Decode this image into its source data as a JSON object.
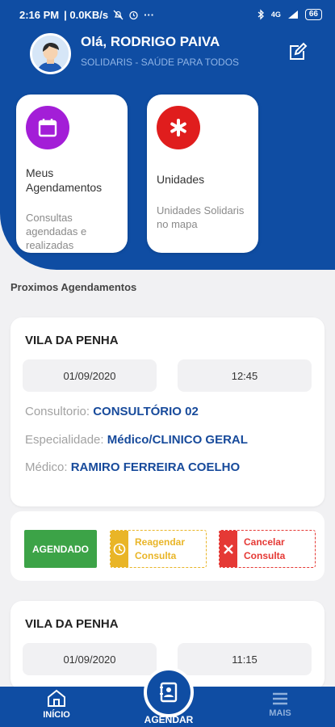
{
  "status_bar": {
    "time": "2:16 PM",
    "speed": "| 0.0KB/s",
    "more": "···",
    "network": "4G",
    "battery": "66"
  },
  "header": {
    "greeting": "Olá, RODRIGO PAIVA",
    "subtitle": "SOLIDARIS - SAÚDE PARA TODOS"
  },
  "cards": [
    {
      "title": "Meus Agendamentos",
      "desc": "Consultas agendadas e realizadas",
      "icon": "calendar-icon",
      "color": "#a31ed7"
    },
    {
      "title": "Unidades",
      "desc": "Unidades Solidaris no mapa",
      "icon": "asterisk-icon",
      "color": "#e01d1d"
    }
  ],
  "section_title": "Proximos Agendamentos",
  "appointments": [
    {
      "unit": "VILA DA PENHA",
      "date": "01/09/2020",
      "time": "12:45",
      "office_label": "Consultorio:",
      "office": "CONSULTÓRIO 02",
      "specialty_label": "Especialidade:",
      "specialty": "Médico/CLINICO GERAL",
      "doctor_label": "Médico:",
      "doctor": "RAMIRO FERREIRA COELHO"
    },
    {
      "unit": "VILA DA PENHA",
      "date": "01/09/2020",
      "time": "11:15"
    }
  ],
  "actions": {
    "status": "AGENDADO",
    "reschedule_line1": "Reagendar",
    "reschedule_line2": "Consulta",
    "cancel_line1": "Cancelar",
    "cancel_line2": "Consulta"
  },
  "nav": {
    "home": "INÍCIO",
    "schedule": "AGENDAR",
    "more": "MAIS"
  },
  "colors": {
    "primary": "#0f4da3",
    "success": "#3ca347",
    "warning": "#e9b527",
    "danger": "#e53935"
  }
}
